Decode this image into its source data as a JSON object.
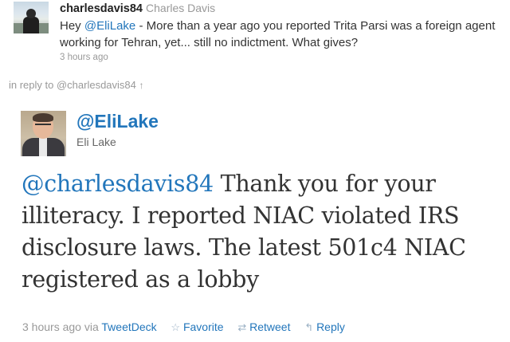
{
  "reply_tweet": {
    "screen_name": "charlesdavis84",
    "full_name": "Charles Davis",
    "text_prefix": "Hey ",
    "mention": "@EliLake",
    "text_suffix": " - More than a year ago you reported Trita Parsi was a foreign agent working for Tehran, yet... still no indictment. What gives?",
    "timestamp": "3 hours ago"
  },
  "in_reply_to": {
    "label": "in reply to @charlesdavis84",
    "arrow": "↑"
  },
  "main_tweet": {
    "screen_name": "@EliLake",
    "full_name": "Eli Lake",
    "mention": "@charlesdavis84",
    "text": " Thank you for your illiteracy. I reported NIAC violated IRS disclosure laws. The latest 501c4 NIAC registered as a lobby"
  },
  "footer": {
    "timestamp": "3 hours ago",
    "via_label": "via",
    "client": "TweetDeck",
    "actions": {
      "favorite": {
        "icon": "☆",
        "label": "Favorite"
      },
      "retweet": {
        "icon": "⇄",
        "label": "Retweet"
      },
      "reply": {
        "icon": "↰",
        "label": "Reply"
      }
    }
  },
  "colors": {
    "link": "#2276bb",
    "muted": "#999999",
    "text": "#333333"
  }
}
